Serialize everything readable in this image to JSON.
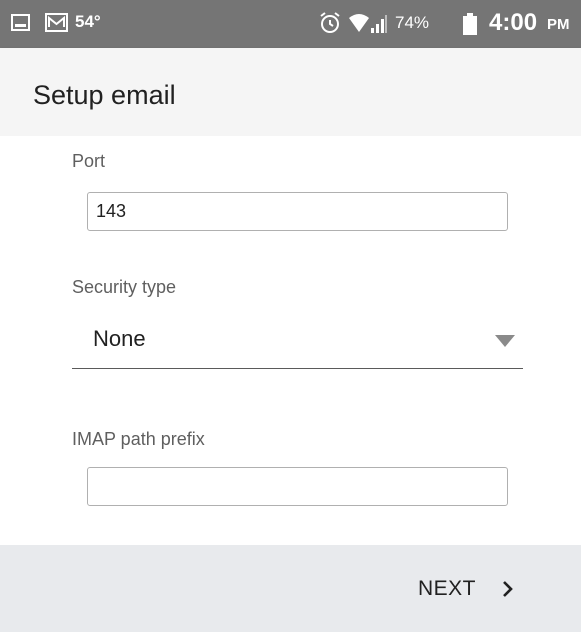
{
  "status_bar": {
    "temperature": "54°",
    "battery_percent": "74%",
    "time": "4:00",
    "ampm": "PM",
    "icons": [
      "gallery-icon",
      "mail-icon",
      "alarm-icon",
      "wifi-icon",
      "signal-icon",
      "battery-icon"
    ]
  },
  "app_bar": {
    "title": "Setup email"
  },
  "form": {
    "port": {
      "label": "Port",
      "value": "143"
    },
    "security_type": {
      "label": "Security type",
      "selected": "None"
    },
    "imap_path_prefix": {
      "label": "IMAP path prefix",
      "value": ""
    }
  },
  "footer": {
    "next_label": "NEXT",
    "next_icon": "chevron-right-icon"
  },
  "colors": {
    "status_bar": "#757575",
    "app_bar": "#f5f5f5",
    "footer": "#e8eaed",
    "text_primary": "#212121",
    "label": "#5f5f5f"
  }
}
